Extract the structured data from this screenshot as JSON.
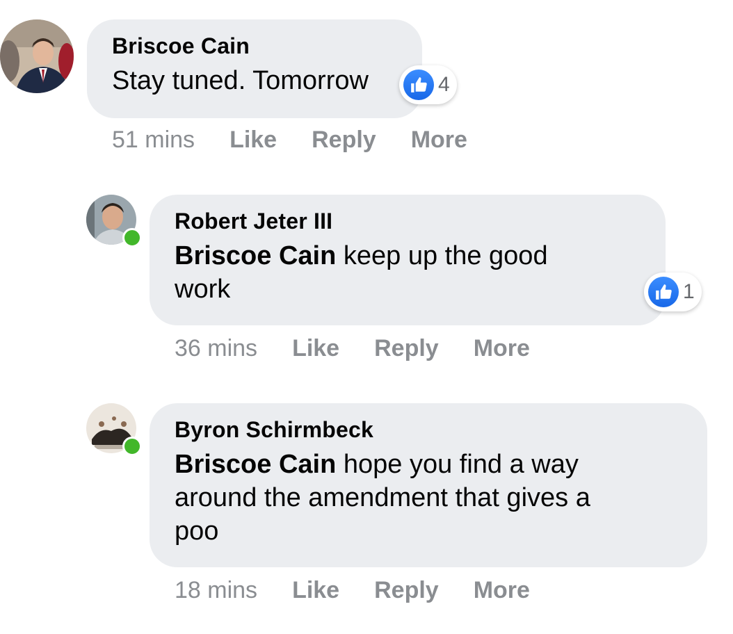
{
  "comments": [
    {
      "author": "Briscoe Cain",
      "text": "Stay tuned. Tomorrow",
      "reactions": {
        "icon": "thumbs-up-icon",
        "count": "4"
      },
      "time": "51 mins",
      "actions": {
        "like": "Like",
        "reply": "Reply",
        "more": "More"
      }
    },
    {
      "author": "Robert Jeter III",
      "mention": "Briscoe Cain",
      "text_line1": " keep up the good",
      "text_line2": "work",
      "online": true,
      "reactions": {
        "icon": "thumbs-up-icon",
        "count": "1"
      },
      "time": "36 mins",
      "actions": {
        "like": "Like",
        "reply": "Reply",
        "more": "More"
      }
    },
    {
      "author": "Byron Schirmbeck",
      "mention": "Briscoe Cain",
      "text_line1": " hope you find a way",
      "text_line2": "around the amendment that gives a",
      "text_line3": "poo",
      "online": true,
      "time": "18 mins",
      "actions": {
        "like": "Like",
        "reply": "Reply",
        "more": "More"
      }
    }
  ],
  "colors": {
    "bubble": "#ebedf0",
    "online": "#42b72a",
    "like_blue": "#1877f2",
    "meta_gray": "#8a8d91"
  }
}
